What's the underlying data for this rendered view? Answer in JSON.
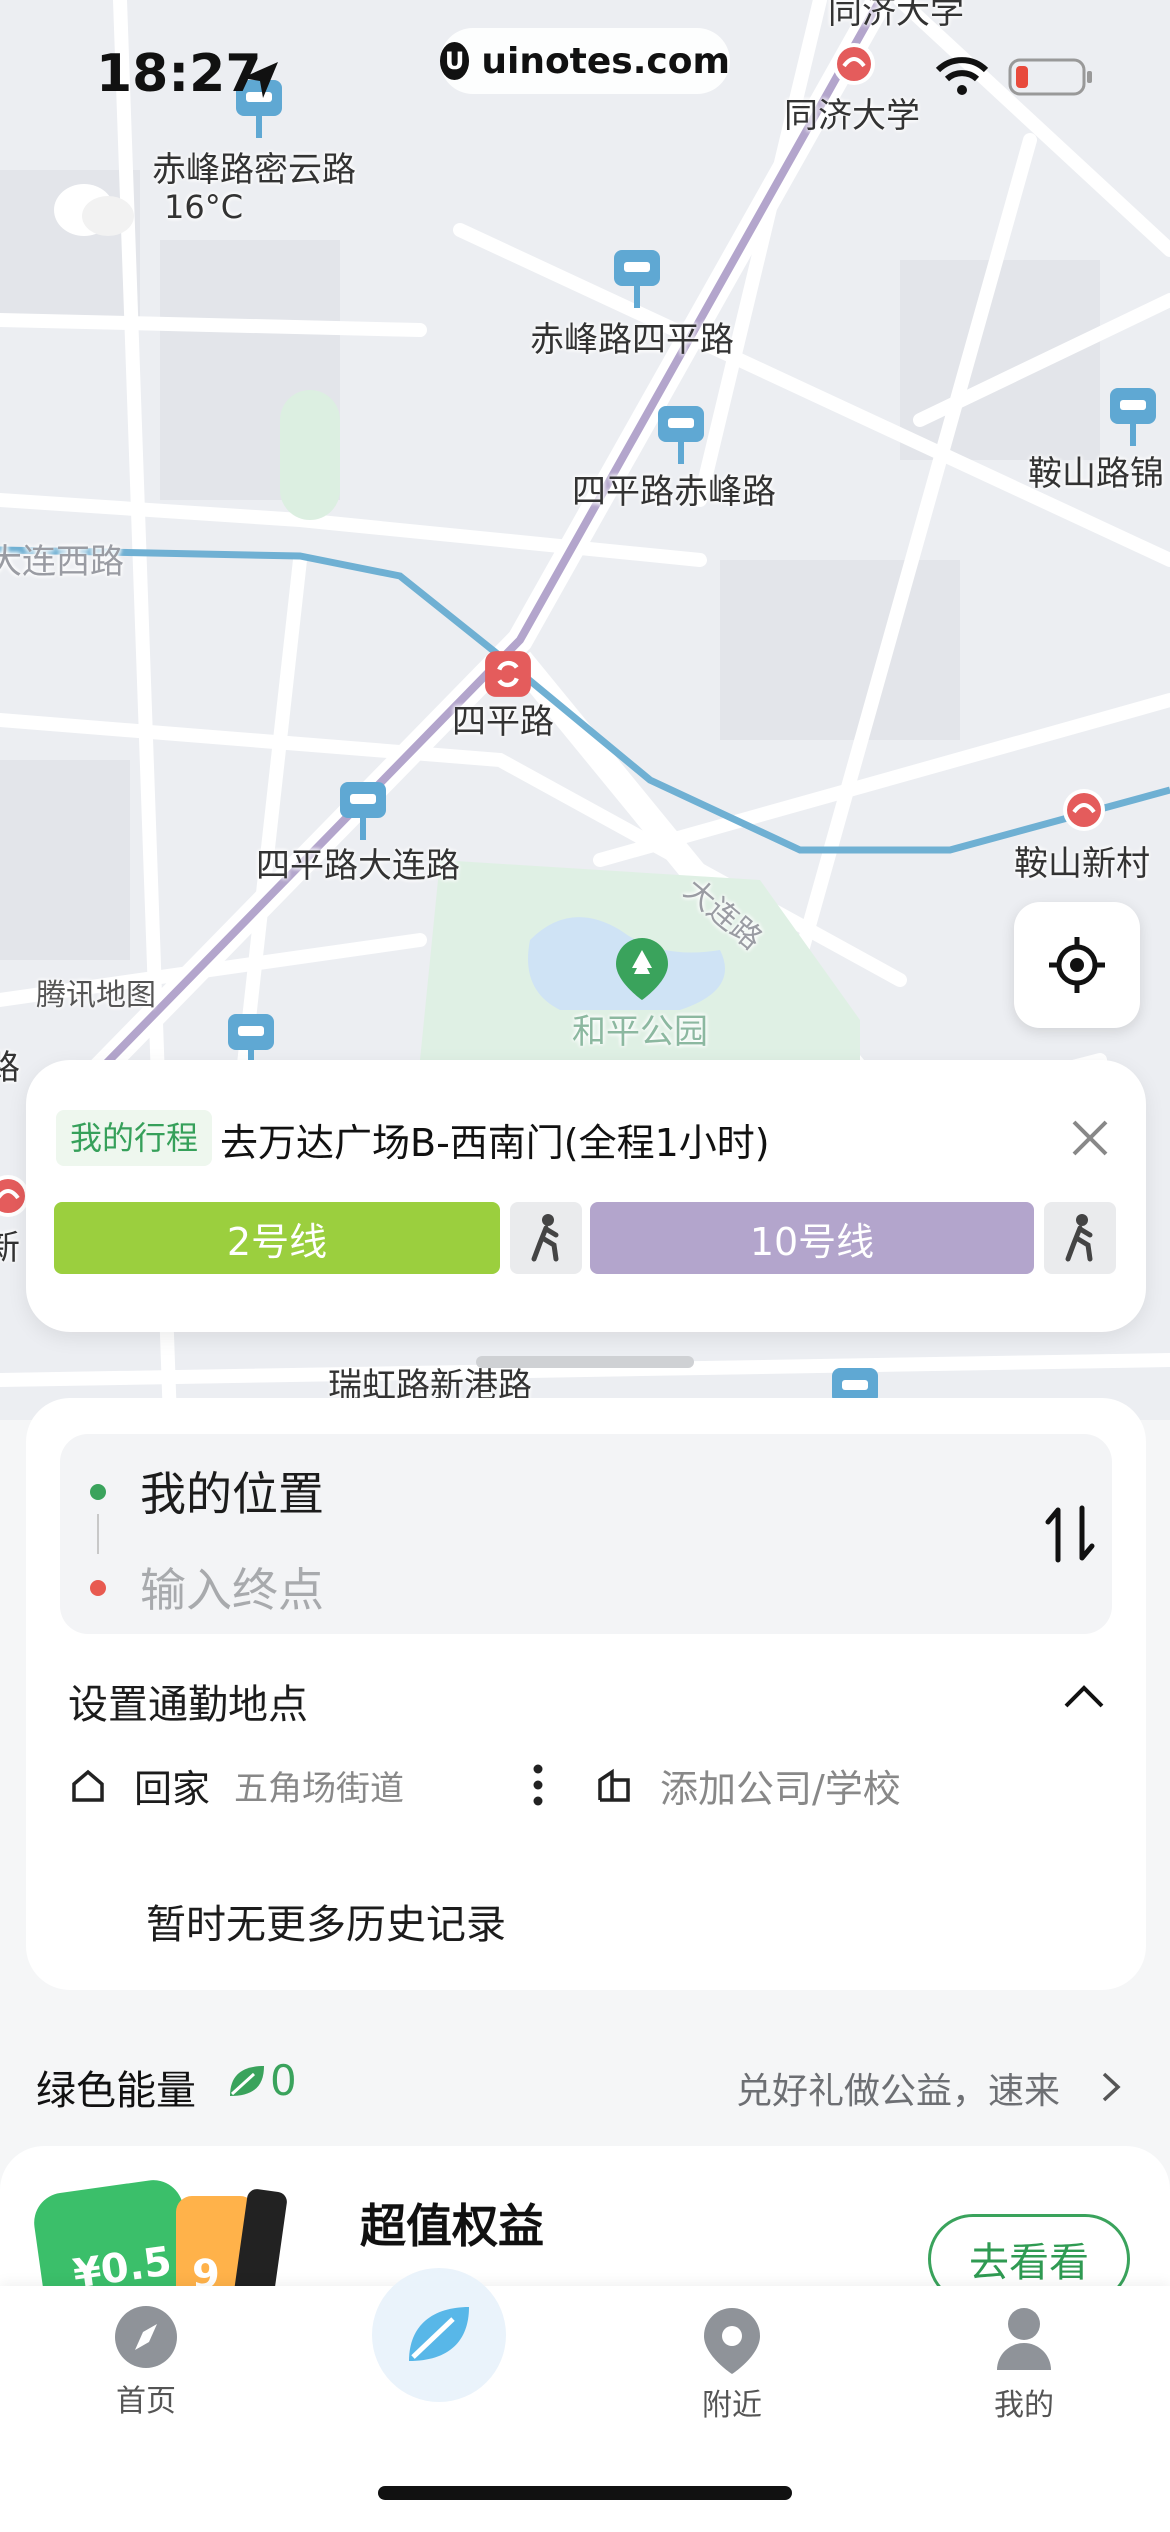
{
  "status": {
    "time": "18:27",
    "watermark": "uinotes.com"
  },
  "map": {
    "labels": {
      "tongji_top": "同济大学",
      "tongji": "同济大学",
      "chifeng_miyun": "赤峰路密云路",
      "weather_temp": "16°C",
      "chifeng_siping": "赤峰路四平路",
      "siping_chifeng": "四平路赤峰路",
      "anshan_jin": "鞍山路锦",
      "dalian_west": "大连西路",
      "siping": "四平路",
      "anshan_xincun": "鞍山新村",
      "siping_dalian": "四平路大连路",
      "dalian_road": "大连路",
      "tencent_map": "腾讯地图",
      "heping_park": "和平公园",
      "ruihong": "瑞虹路新港路",
      "left_edge_1": "路",
      "left_edge_2": "新"
    },
    "colors": {
      "line2": "#9bcf3e",
      "line10": "#b3a5cc",
      "line_blue": "#6fb0d3",
      "metro_red": "#e45c5c",
      "bus_blue": "#5fa8d3"
    }
  },
  "trip": {
    "tag": "我的行程",
    "title": "去万达广场B-西南门(全程1小时)",
    "segments": [
      {
        "label": "2号线",
        "color": "#9bcf3e"
      },
      {
        "label": "10号线",
        "color": "#b3a5cc"
      }
    ]
  },
  "search": {
    "origin": "我的位置",
    "destination_placeholder": "输入终点",
    "commute_title": "设置通勤地点",
    "home_label": "回家",
    "home_addr": "五角场街道",
    "work_label": "添加公司/学校",
    "history_empty": "暂时无更多历史记录"
  },
  "energy": {
    "title": "绿色能量",
    "count": "0",
    "link": "兑好礼做公益，速来"
  },
  "promo": {
    "title": "超值权益",
    "button": "去看看",
    "coupon_1": "¥0.5",
    "coupon_2": "9"
  },
  "tabs": {
    "home": "首页",
    "nearby": "附近",
    "mine": "我的"
  }
}
